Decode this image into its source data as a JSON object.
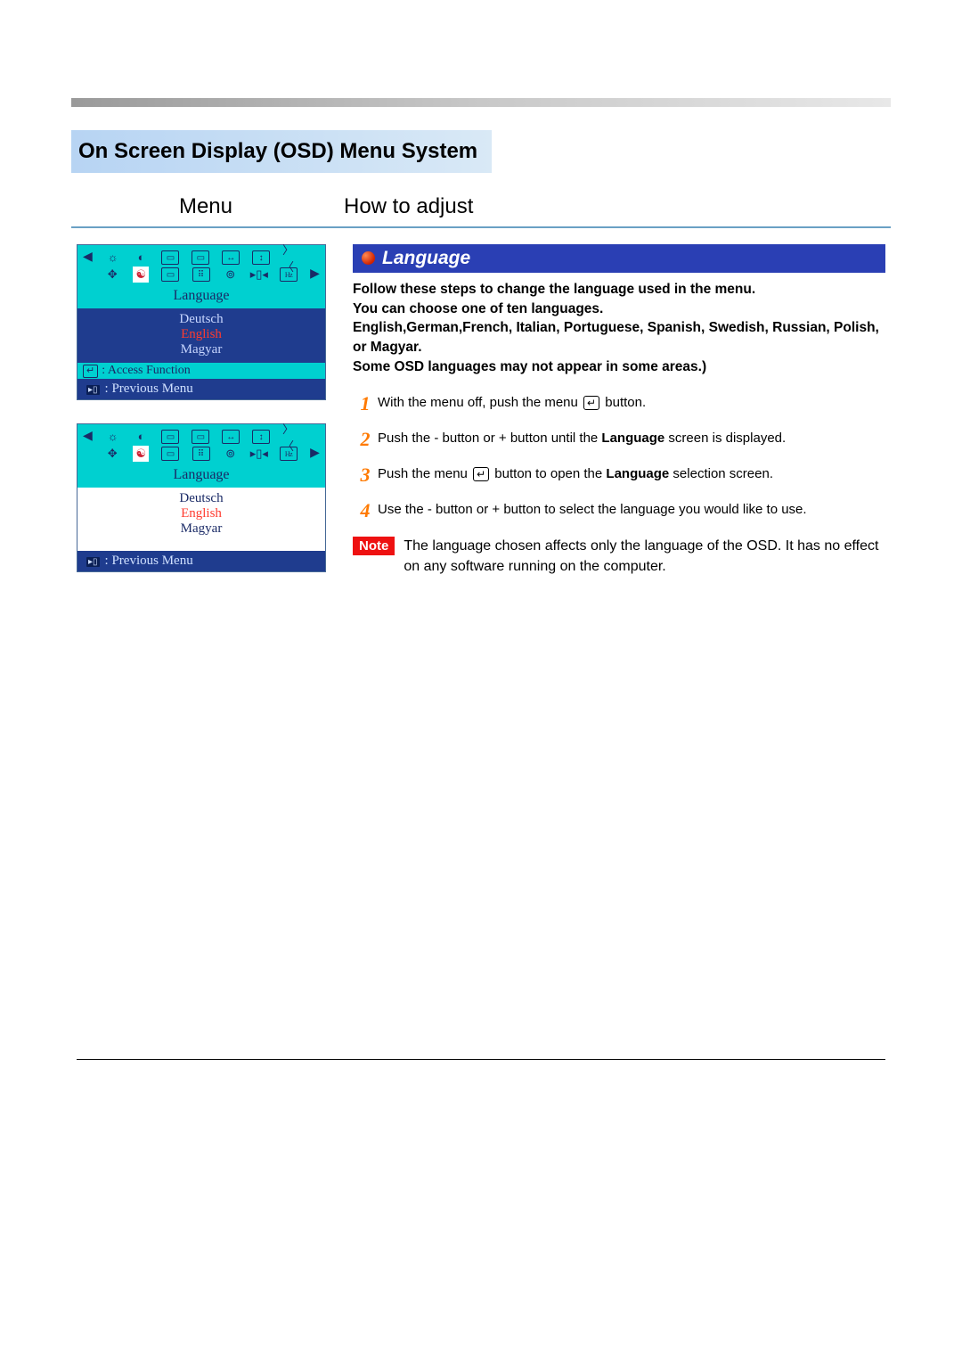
{
  "title": "On Screen Display (OSD) Menu System",
  "left_heading": "Menu",
  "right_heading": "How to adjust",
  "osd": {
    "title": "Language",
    "languages": [
      "Deutsch",
      "English",
      "Magyar"
    ],
    "selected_index": 1,
    "access_label": ": Access Function",
    "previous_label": ":  Previous Menu"
  },
  "section": {
    "heading": "Language",
    "lead_line1": "Follow these steps to change the language used in the menu.",
    "lead_line2": "You can choose one of ten languages.",
    "lead_line3": "English,German,French, Italian, Portuguese, Spanish,  Swedish, Russian, Polish, or Magyar.",
    "lead_line4": "Some OSD languages may not appear in some areas.)"
  },
  "steps": [
    {
      "n": "1",
      "before": "With the menu off, push the menu ",
      "after": " button."
    },
    {
      "n": "2",
      "text": "Push the  - button or  + button until the <b>Language</b> screen is displayed."
    },
    {
      "n": "3",
      "before": "Push the menu ",
      "after": " button to open the <b>Language</b> selection screen."
    },
    {
      "n": "4",
      "text": "Use the - button or + button to select the language you would like to use."
    }
  ],
  "note": {
    "tag": "Note",
    "text": "The language chosen affects only the language of the OSD. It has no effect on any software running on the computer."
  }
}
